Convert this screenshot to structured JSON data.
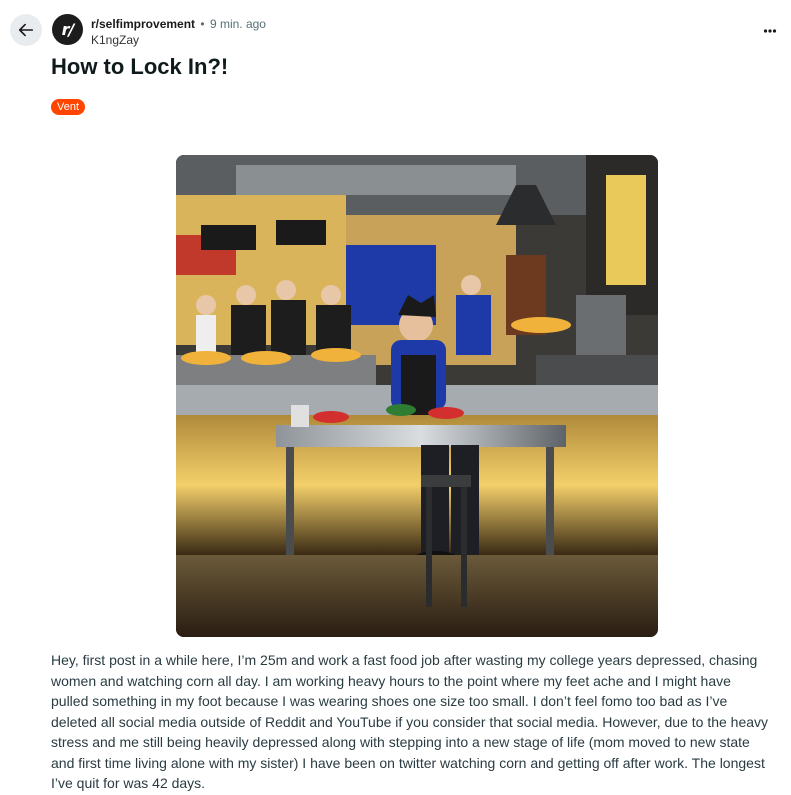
{
  "post": {
    "subreddit": "r/selfimprovement",
    "separator": "•",
    "time": "9 min. ago",
    "author": "K1ngZay",
    "title": "How to Lock In?!",
    "flair": "Vent",
    "body": "Hey, first post in a while here, I’m 25m and work a fast food job after wasting my college years depressed, chasing women and watching corn all day. I am working heavy hours to the point where my feet ache and I might have pulled something in my foot because I was wearing shoes one size too small. I don’t feel fomo too bad as I’ve deleted all social media outside of Reddit and YouTube if you consider that social media. However, due to the heavy stress and me still being heavily depressed along with stepping into a new stage of life (mom moved to new state and first time living alone with my sister) I have been on twitter watching corn and getting off after work. The longest I’ve quit for was 42 days."
  },
  "avatar": {
    "glyph": "r/"
  },
  "icons": {
    "back": "arrow-left-icon",
    "more": "overflow-menu-icon"
  },
  "colors": {
    "flair_bg": "#ff4500",
    "back_bg": "#e9ecee",
    "avatar_bg": "#1c1c1c",
    "meta_text": "#576f76"
  }
}
